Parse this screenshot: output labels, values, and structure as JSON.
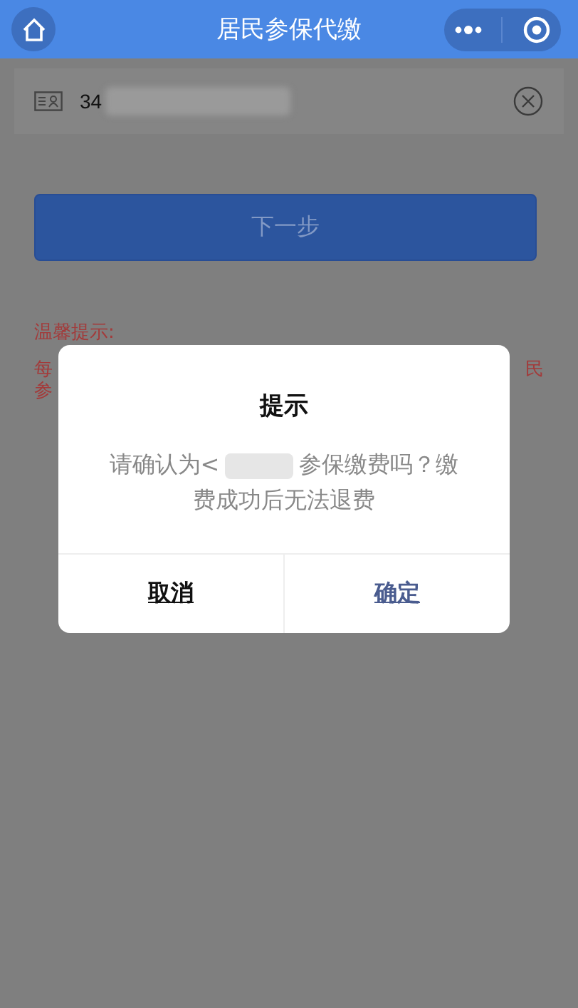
{
  "header": {
    "title": "居民参保代缴"
  },
  "id_field": {
    "value": "34"
  },
  "next_button": {
    "label": "下一步",
    "disabled": true
  },
  "tip": {
    "title": "温馨提示:",
    "lines": [
      {
        "left": "每",
        "right": "民"
      },
      {
        "left": "参"
      }
    ]
  },
  "dialog": {
    "title": "提示",
    "message_before": "请确认为<",
    "message_after": "参保缴费吗？缴费成功后无法退费",
    "buttons": [
      {
        "label": "取消",
        "kind": "cancel"
      },
      {
        "label": "确定",
        "kind": "confirm"
      }
    ]
  }
}
